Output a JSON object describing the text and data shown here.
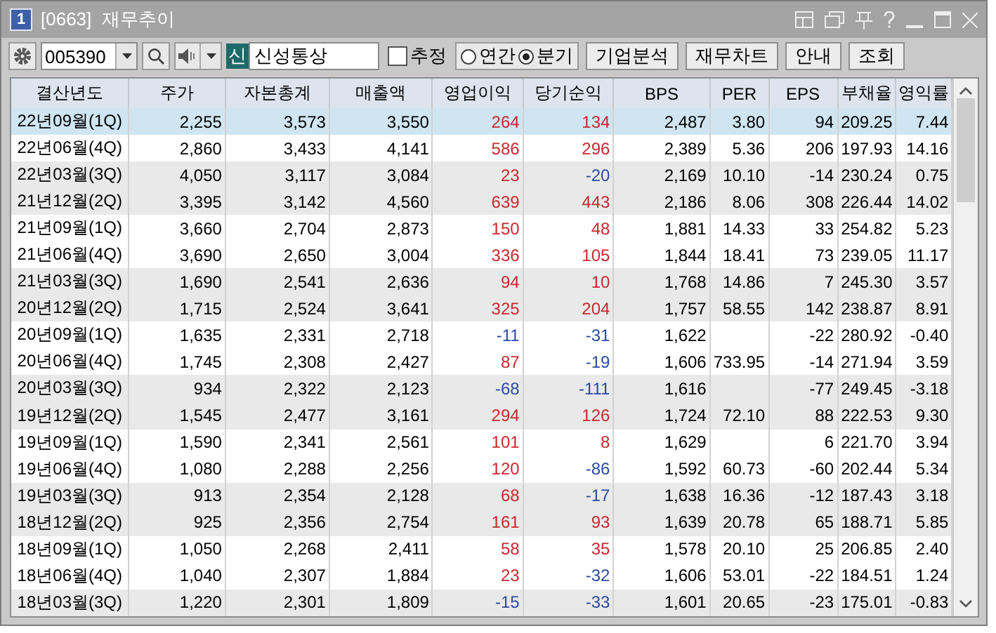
{
  "window": {
    "badge": "1",
    "title": "[0663]  재무추이"
  },
  "toolbar": {
    "code": "005390",
    "market_badge": "신",
    "name": "신성통상",
    "estimate": {
      "label": "추정",
      "checked": false
    },
    "period": [
      {
        "label": "연간",
        "selected": false
      },
      {
        "label": "분기",
        "selected": true
      }
    ],
    "buttons": [
      "기업분석",
      "재무차트",
      "안내",
      "조회"
    ]
  },
  "table": {
    "columns": [
      "결산년도",
      "주가",
      "자본총계",
      "매출액",
      "영업이익",
      "당기순익",
      "BPS",
      "PER",
      "EPS",
      "부채율",
      "영익률"
    ],
    "rows": [
      {
        "selected": true,
        "op_up": true,
        "net_up": true,
        "cells": [
          "22년09월(1Q)",
          "2,255",
          "3,573",
          "3,550",
          "264",
          "134",
          "2,487",
          "3.80",
          "94",
          "209.25",
          "7.44"
        ]
      },
      {
        "selected": false,
        "op_up": true,
        "net_up": true,
        "cells": [
          "22년06월(4Q)",
          "2,860",
          "3,433",
          "4,141",
          "586",
          "296",
          "2,389",
          "5.36",
          "206",
          "197.93",
          "14.16"
        ]
      },
      {
        "selected": false,
        "op_up": true,
        "net_up": false,
        "cells": [
          "22년03월(3Q)",
          "4,050",
          "3,117",
          "3,084",
          "23",
          "-20",
          "2,169",
          "10.10",
          "-14",
          "230.24",
          "0.75"
        ]
      },
      {
        "selected": false,
        "op_up": true,
        "net_up": true,
        "cells": [
          "21년12월(2Q)",
          "3,395",
          "3,142",
          "4,560",
          "639",
          "443",
          "2,186",
          "8.06",
          "308",
          "226.44",
          "14.02"
        ]
      },
      {
        "selected": false,
        "op_up": true,
        "net_up": true,
        "cells": [
          "21년09월(1Q)",
          "3,660",
          "2,704",
          "2,873",
          "150",
          "48",
          "1,881",
          "14.33",
          "33",
          "254.82",
          "5.23"
        ]
      },
      {
        "selected": false,
        "op_up": true,
        "net_up": true,
        "cells": [
          "21년06월(4Q)",
          "3,690",
          "2,650",
          "3,004",
          "336",
          "105",
          "1,844",
          "18.41",
          "73",
          "239.05",
          "11.17"
        ]
      },
      {
        "selected": false,
        "op_up": true,
        "net_up": true,
        "cells": [
          "21년03월(3Q)",
          "1,690",
          "2,541",
          "2,636",
          "94",
          "10",
          "1,768",
          "14.86",
          "7",
          "245.30",
          "3.57"
        ]
      },
      {
        "selected": false,
        "op_up": true,
        "net_up": true,
        "cells": [
          "20년12월(2Q)",
          "1,715",
          "2,524",
          "3,641",
          "325",
          "204",
          "1,757",
          "58.55",
          "142",
          "238.87",
          "8.91"
        ]
      },
      {
        "selected": false,
        "op_up": false,
        "net_up": false,
        "cells": [
          "20년09월(1Q)",
          "1,635",
          "2,331",
          "2,718",
          "-11",
          "-31",
          "1,622",
          "",
          "-22",
          "280.92",
          "-0.40"
        ]
      },
      {
        "selected": false,
        "op_up": true,
        "net_up": false,
        "cells": [
          "20년06월(4Q)",
          "1,745",
          "2,308",
          "2,427",
          "87",
          "-19",
          "1,606",
          "733.95",
          "-14",
          "271.94",
          "3.59"
        ]
      },
      {
        "selected": false,
        "op_up": false,
        "net_up": false,
        "cells": [
          "20년03월(3Q)",
          "934",
          "2,322",
          "2,123",
          "-68",
          "-111",
          "1,616",
          "",
          "-77",
          "249.45",
          "-3.18"
        ]
      },
      {
        "selected": false,
        "op_up": true,
        "net_up": true,
        "cells": [
          "19년12월(2Q)",
          "1,545",
          "2,477",
          "3,161",
          "294",
          "126",
          "1,724",
          "72.10",
          "88",
          "222.53",
          "9.30"
        ]
      },
      {
        "selected": false,
        "op_up": true,
        "net_up": true,
        "cells": [
          "19년09월(1Q)",
          "1,590",
          "2,341",
          "2,561",
          "101",
          "8",
          "1,629",
          "",
          "6",
          "221.70",
          "3.94"
        ]
      },
      {
        "selected": false,
        "op_up": true,
        "net_up": false,
        "cells": [
          "19년06월(4Q)",
          "1,080",
          "2,288",
          "2,256",
          "120",
          "-86",
          "1,592",
          "60.73",
          "-60",
          "202.44",
          "5.34"
        ]
      },
      {
        "selected": false,
        "op_up": true,
        "net_up": false,
        "cells": [
          "19년03월(3Q)",
          "913",
          "2,354",
          "2,128",
          "68",
          "-17",
          "1,638",
          "16.36",
          "-12",
          "187.43",
          "3.18"
        ]
      },
      {
        "selected": false,
        "op_up": true,
        "net_up": true,
        "cells": [
          "18년12월(2Q)",
          "925",
          "2,356",
          "2,754",
          "161",
          "93",
          "1,639",
          "20.78",
          "65",
          "188.71",
          "5.85"
        ]
      },
      {
        "selected": false,
        "op_up": true,
        "net_up": true,
        "cells": [
          "18년09월(1Q)",
          "1,050",
          "2,268",
          "2,411",
          "58",
          "35",
          "1,578",
          "20.10",
          "25",
          "206.85",
          "2.40"
        ]
      },
      {
        "selected": false,
        "op_up": true,
        "net_up": false,
        "cells": [
          "18년06월(4Q)",
          "1,040",
          "2,307",
          "1,884",
          "23",
          "-32",
          "1,606",
          "53.01",
          "-22",
          "184.51",
          "1.24"
        ]
      },
      {
        "selected": false,
        "op_up": false,
        "net_up": false,
        "cells": [
          "18년03월(3Q)",
          "1,220",
          "2,301",
          "1,809",
          "-15",
          "-33",
          "1,601",
          "20.65",
          "-23",
          "175.01",
          "-0.83"
        ]
      }
    ]
  }
}
